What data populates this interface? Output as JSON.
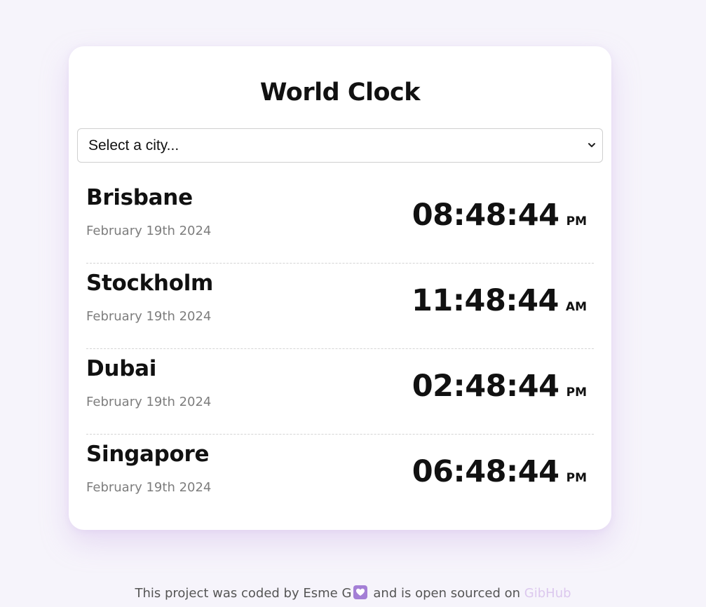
{
  "app": {
    "title": "World Clock"
  },
  "city_select": {
    "selected_label": "Select a city..."
  },
  "cities": [
    {
      "name": "Brisbane",
      "date": "February 19th 2024",
      "time": "08:48:44",
      "ampm": "PM"
    },
    {
      "name": "Stockholm",
      "date": "February 19th 2024",
      "time": "11:48:44",
      "ampm": "AM"
    },
    {
      "name": "Dubai",
      "date": "February 19th 2024",
      "time": "02:48:44",
      "ampm": "PM"
    },
    {
      "name": "Singapore",
      "date": "February 19th 2024",
      "time": "06:48:44",
      "ampm": "PM"
    }
  ],
  "footer": {
    "text_before": "This project was coded by Esme G",
    "text_middle": "and is open sourced on",
    "link_label": "GibHub"
  },
  "colors": {
    "background": "#f6f4fb",
    "card": "#ffffff",
    "accent": "#a47fd6",
    "link": "#dcc8ee",
    "date_text": "#7d7d7d"
  },
  "icons": {
    "select_chevron": "chevron-down-icon",
    "footer_heart": "heart-icon"
  }
}
